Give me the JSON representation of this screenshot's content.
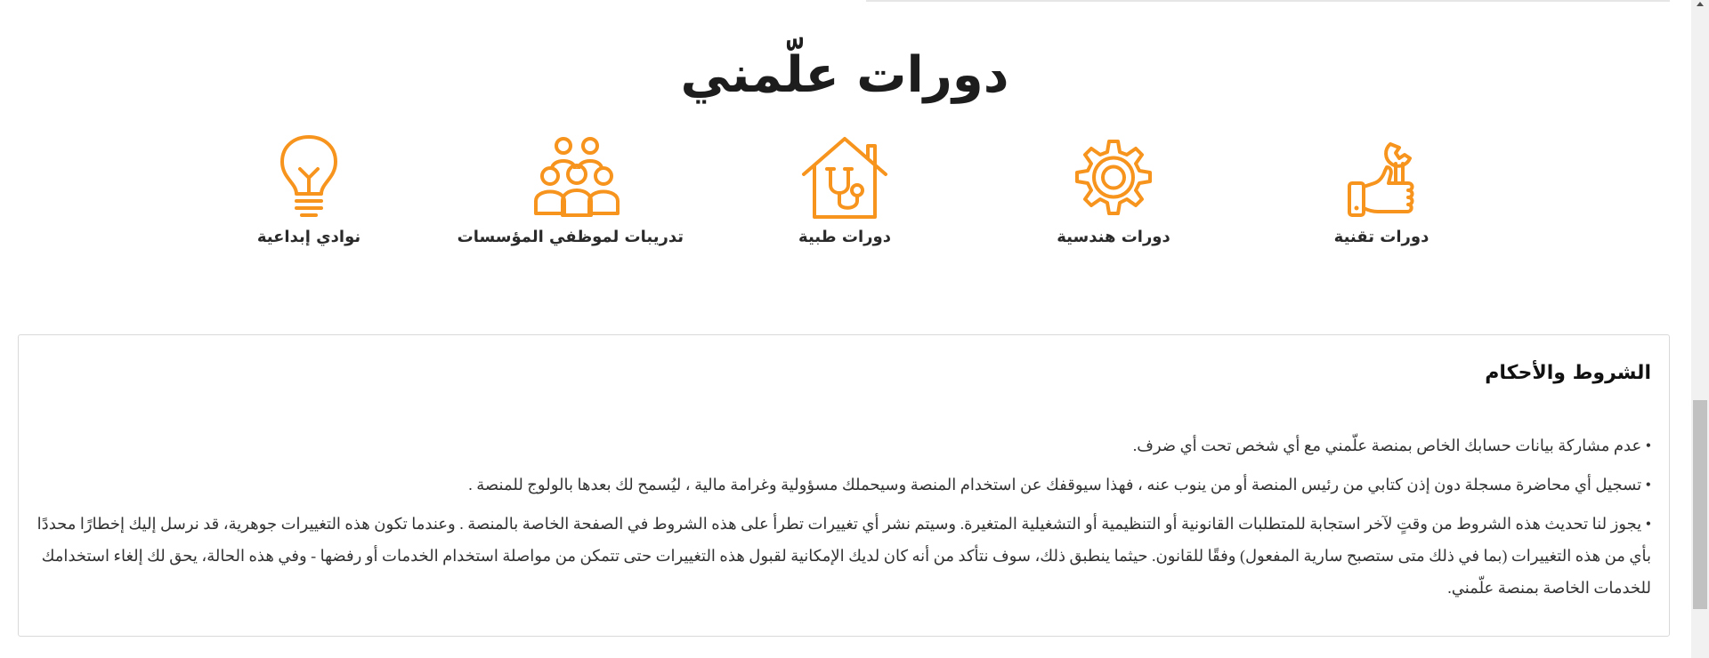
{
  "section": {
    "title": "دورات علّمني"
  },
  "categories": [
    {
      "label": "دورات تقنية",
      "icon": "wrench-thumbs-up-icon"
    },
    {
      "label": "دورات هندسية",
      "icon": "gear-icon"
    },
    {
      "label": "دورات طبية",
      "icon": "house-stethoscope-icon"
    },
    {
      "label": "تدريبات لموظفي المؤسسات",
      "icon": "group-people-icon"
    },
    {
      "label": "نوادي إبداعية",
      "icon": "lightbulb-icon"
    }
  ],
  "colors": {
    "accent": "#F7941D"
  },
  "terms": {
    "title": "الشروط والأحكام",
    "items": [
      "• عدم مشاركة بيانات حسابك الخاص بمنصة علّمني مع أي شخص تحت أي ضرف.",
      "• تسجيل أي محاضرة مسجلة دون إذن كتابي من رئيس المنصة أو من ينوب عنه ، فهذا سيوقفك عن استخدام المنصة وسيحملك مسؤولية وغرامة مالية ، ليُسمح لك بعدها بالولوج للمنصة .",
      "• يجوز لنا تحديث هذه الشروط من وقتٍ لآخر استجابة للمتطلبات القانونية أو التنظيمية أو التشغيلية المتغيرة. وسيتم نشر أي تغييرات تطرأ على هذه الشروط في الصفحة الخاصة بالمنصة . وعندما تكون هذه التغييرات جوهرية، قد نرسل إليك إخطارًا محددًا بأي من هذه التغييرات (بما في ذلك متى ستصبح سارية المفعول) وفقًا للقانون. حيثما ينطبق ذلك، سوف نتأكد من أنه كان لديك الإمكانية لقبول هذه التغييرات حتى تتمكن من مواصلة استخدام الخدمات أو رفضها - وفي هذه الحالة، يحق لك إلغاء استخدامك للخدمات الخاصة بمنصة علّمني."
    ]
  }
}
